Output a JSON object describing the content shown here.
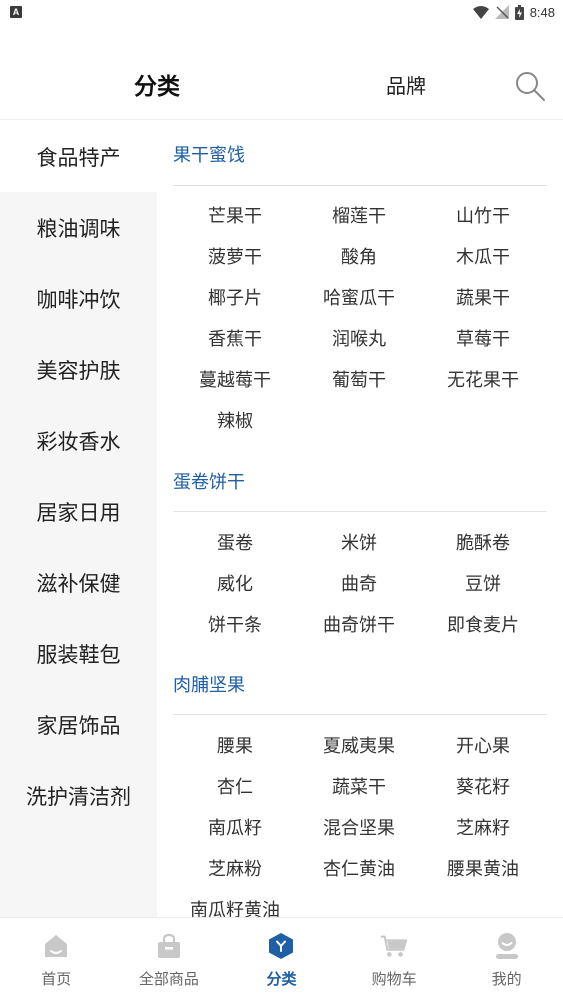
{
  "status_bar": {
    "time": "8:48",
    "app_letter": "A"
  },
  "header": {
    "tab_category": "分类",
    "tab_brand": "品牌"
  },
  "sidebar": {
    "items": [
      "食品特产",
      "粮油调味",
      "咖啡冲饮",
      "美容护肤",
      "彩妆香水",
      "居家日用",
      "滋补保健",
      "服装鞋包",
      "家居饰品",
      "洗护清洁剂"
    ]
  },
  "sections": [
    {
      "title": "果干蜜饯",
      "rows": [
        [
          "芒果干",
          "榴莲干",
          "山竹干"
        ],
        [
          "菠萝干",
          "酸角",
          "木瓜干"
        ],
        [
          "椰子片",
          "哈蜜瓜干",
          "蔬果干"
        ],
        [
          "香蕉干",
          "润喉丸",
          "草莓干"
        ],
        [
          "蔓越莓干",
          "葡萄干",
          "无花果干"
        ],
        [
          "辣椒"
        ]
      ]
    },
    {
      "title": "蛋卷饼干",
      "rows": [
        [
          "蛋卷",
          "米饼",
          "脆酥卷"
        ],
        [
          "威化",
          "曲奇",
          "豆饼"
        ],
        [
          "饼干条",
          "曲奇饼干",
          "即食麦片"
        ]
      ]
    },
    {
      "title": "肉脯坚果",
      "rows": [
        [
          "腰果",
          "夏威夷果",
          "开心果"
        ],
        [
          "杏仁",
          "蔬菜干",
          "葵花籽"
        ],
        [
          "南瓜籽",
          "混合坚果",
          "芝麻籽"
        ],
        [
          "芝麻粉",
          "杏仁黄油",
          "腰果黄油"
        ],
        [
          "南瓜籽黄油"
        ]
      ]
    }
  ],
  "bottom_nav": {
    "items": [
      {
        "label": "首页",
        "icon": "home-icon"
      },
      {
        "label": "全部商品",
        "icon": "bag-icon"
      },
      {
        "label": "分类",
        "icon": "category-icon"
      },
      {
        "label": "购物车",
        "icon": "cart-icon"
      },
      {
        "label": "我的",
        "icon": "profile-icon"
      }
    ],
    "active_index": 2
  },
  "colors": {
    "accent": "#1f5fa5",
    "sidebar_bg": "#f6f6f6",
    "icon_inactive": "#c8c8c8"
  }
}
